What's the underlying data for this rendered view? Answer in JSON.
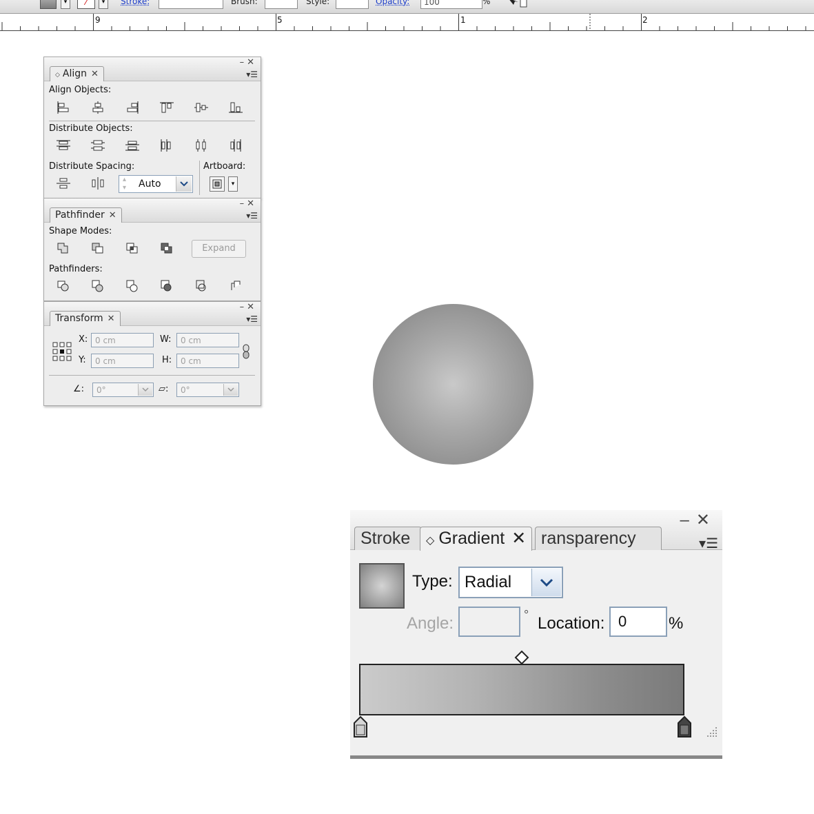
{
  "control_bar": {
    "stroke_label": "Stroke:",
    "brush_label": "Brush:",
    "style_label": "Style:",
    "opacity_label": "Opacity:",
    "opacity_value": "100",
    "opacity_unit": "%"
  },
  "ruler": {
    "labels": [
      "9",
      "5",
      "1",
      "2"
    ]
  },
  "align_panel": {
    "tab_label": "Align",
    "align_objects_label": "Align Objects:",
    "distribute_objects_label": "Distribute Objects:",
    "distribute_spacing_label": "Distribute Spacing:",
    "artboard_label": "Artboard:",
    "spacing_value": "Auto",
    "align_icons": [
      "horizontal-align-left-icon",
      "horizontal-align-center-icon",
      "horizontal-align-right-icon",
      "vertical-align-top-icon",
      "vertical-align-center-icon",
      "vertical-align-bottom-icon"
    ],
    "distribute_icons": [
      "vertical-distribute-top-icon",
      "vertical-distribute-center-icon",
      "vertical-distribute-bottom-icon",
      "horizontal-distribute-left-icon",
      "horizontal-distribute-center-icon",
      "horizontal-distribute-right-icon"
    ]
  },
  "pathfinder_panel": {
    "tab_label": "Pathfinder",
    "shape_modes_label": "Shape Modes:",
    "pathfinders_label": "Pathfinders:",
    "expand_label": "Expand",
    "shape_mode_icons": [
      "unite-icon",
      "minus-front-icon",
      "intersect-icon",
      "exclude-icon"
    ],
    "pathfinder_icons": [
      "divide-icon",
      "trim-icon",
      "merge-icon",
      "crop-icon",
      "outline-icon",
      "minus-back-icon"
    ]
  },
  "transform_panel": {
    "tab_label": "Transform",
    "x_label": "X:",
    "y_label": "Y:",
    "w_label": "W:",
    "h_label": "H:",
    "x_value": "0 cm",
    "y_value": "0 cm",
    "w_value": "0 cm",
    "h_value": "0 cm",
    "rotate_label": ":",
    "shear_label": ":",
    "rotate_value": "0°",
    "shear_value": "0°"
  },
  "gradient_panel": {
    "tabs": [
      "Stroke",
      "Gradient",
      "ransparency"
    ],
    "active_tab": "Gradient",
    "type_label": "Type:",
    "type_value": "Radial",
    "angle_label": "Angle:",
    "angle_value": "",
    "angle_unit": "°",
    "location_label": "Location:",
    "location_value": "0",
    "location_unit": "%"
  },
  "colors": {
    "panel_bg": "#ededed",
    "gradient_start": "#cbcbcb",
    "gradient_end": "#7a7a7a"
  }
}
